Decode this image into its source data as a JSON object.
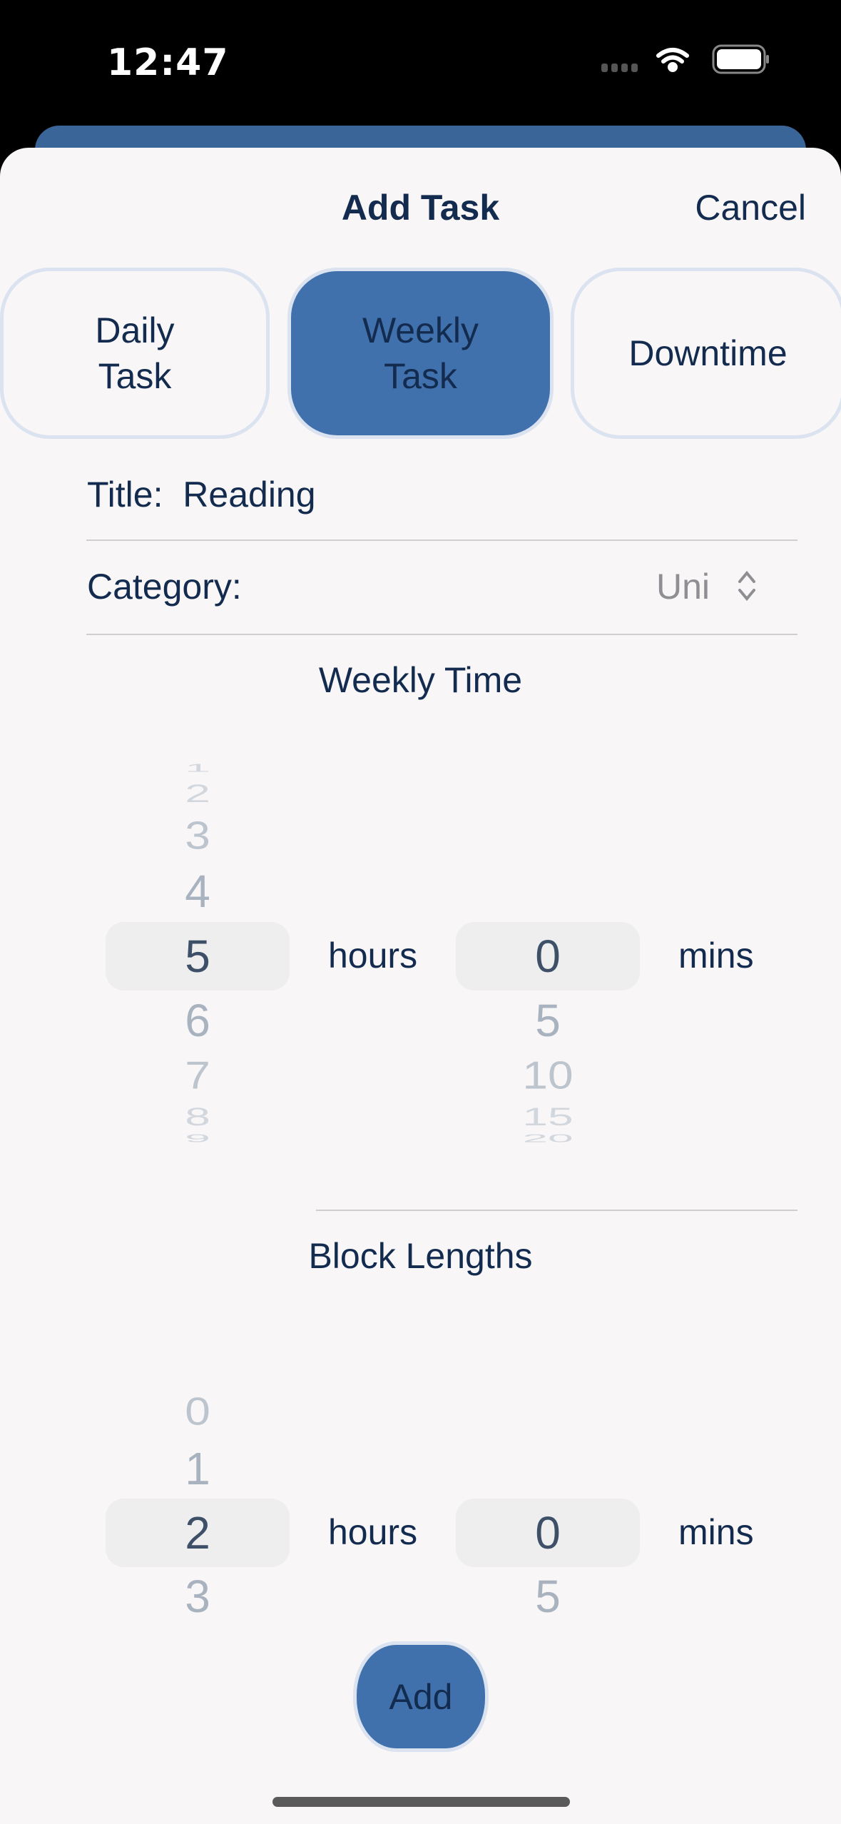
{
  "status_bar": {
    "time": "12:47",
    "icons": [
      "signal-dots-icon",
      "wifi-icon",
      "battery-icon"
    ]
  },
  "header": {
    "title": "Add Task",
    "cancel": "Cancel"
  },
  "segments": [
    {
      "label_line1": "Daily",
      "label_line2": "Task",
      "selected": false
    },
    {
      "label_line1": "Weekly",
      "label_line2": "Task",
      "selected": true
    },
    {
      "label_line1": "Downtime",
      "label_line2": "",
      "selected": false
    }
  ],
  "form": {
    "title_label": "Title:",
    "title_value": "Reading",
    "category_label": "Category:",
    "category_value": "Uni"
  },
  "weekly_time": {
    "heading": "Weekly Time",
    "hours": {
      "values": [
        "1",
        "2",
        "3",
        "4",
        "5",
        "6",
        "7",
        "8",
        "9"
      ],
      "selected": "5",
      "unit": "hours"
    },
    "mins": {
      "values": [
        "0",
        "5",
        "10",
        "15",
        "20"
      ],
      "selected": "0",
      "unit": "mins"
    }
  },
  "block_lengths": {
    "heading": "Block Lengths",
    "hours": {
      "values": [
        "0",
        "1",
        "2",
        "3"
      ],
      "selected": "2",
      "unit": "hours"
    },
    "mins": {
      "values": [
        "0",
        "5"
      ],
      "selected": "0",
      "unit": "mins"
    }
  },
  "add_button": "Add",
  "colors": {
    "accent": "#4171ad",
    "text": "#132b4e",
    "back_card": "#3a6599"
  }
}
